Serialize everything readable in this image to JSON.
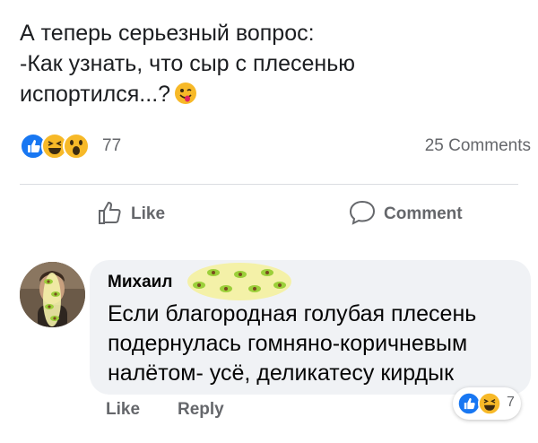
{
  "post": {
    "lines": [
      "А теперь серьезный вопрос:",
      "-Как узнать, что сыр с плесенью",
      "испортился...?"
    ],
    "emoji": "winking-tongue-emoji"
  },
  "reactions": {
    "icons": [
      "like-icon",
      "laugh-icon",
      "wow-icon"
    ],
    "count": "77",
    "comments": "25 Comments"
  },
  "actions": {
    "like": "Like",
    "comment": "Comment"
  },
  "comment": {
    "author": "Михаил",
    "lines": [
      "Если благородная голубая плесень",
      "подернулась гомняно-коричневым",
      "налётом- усё, деликатесу кирдык"
    ],
    "like": "Like",
    "reply": "Reply",
    "reaction_count": "7"
  },
  "colors": {
    "like_blue": "#1877f2",
    "emoji_yellow": "#f7b928",
    "bubble_bg": "#f0f2f5",
    "muted_text": "#65676b"
  }
}
